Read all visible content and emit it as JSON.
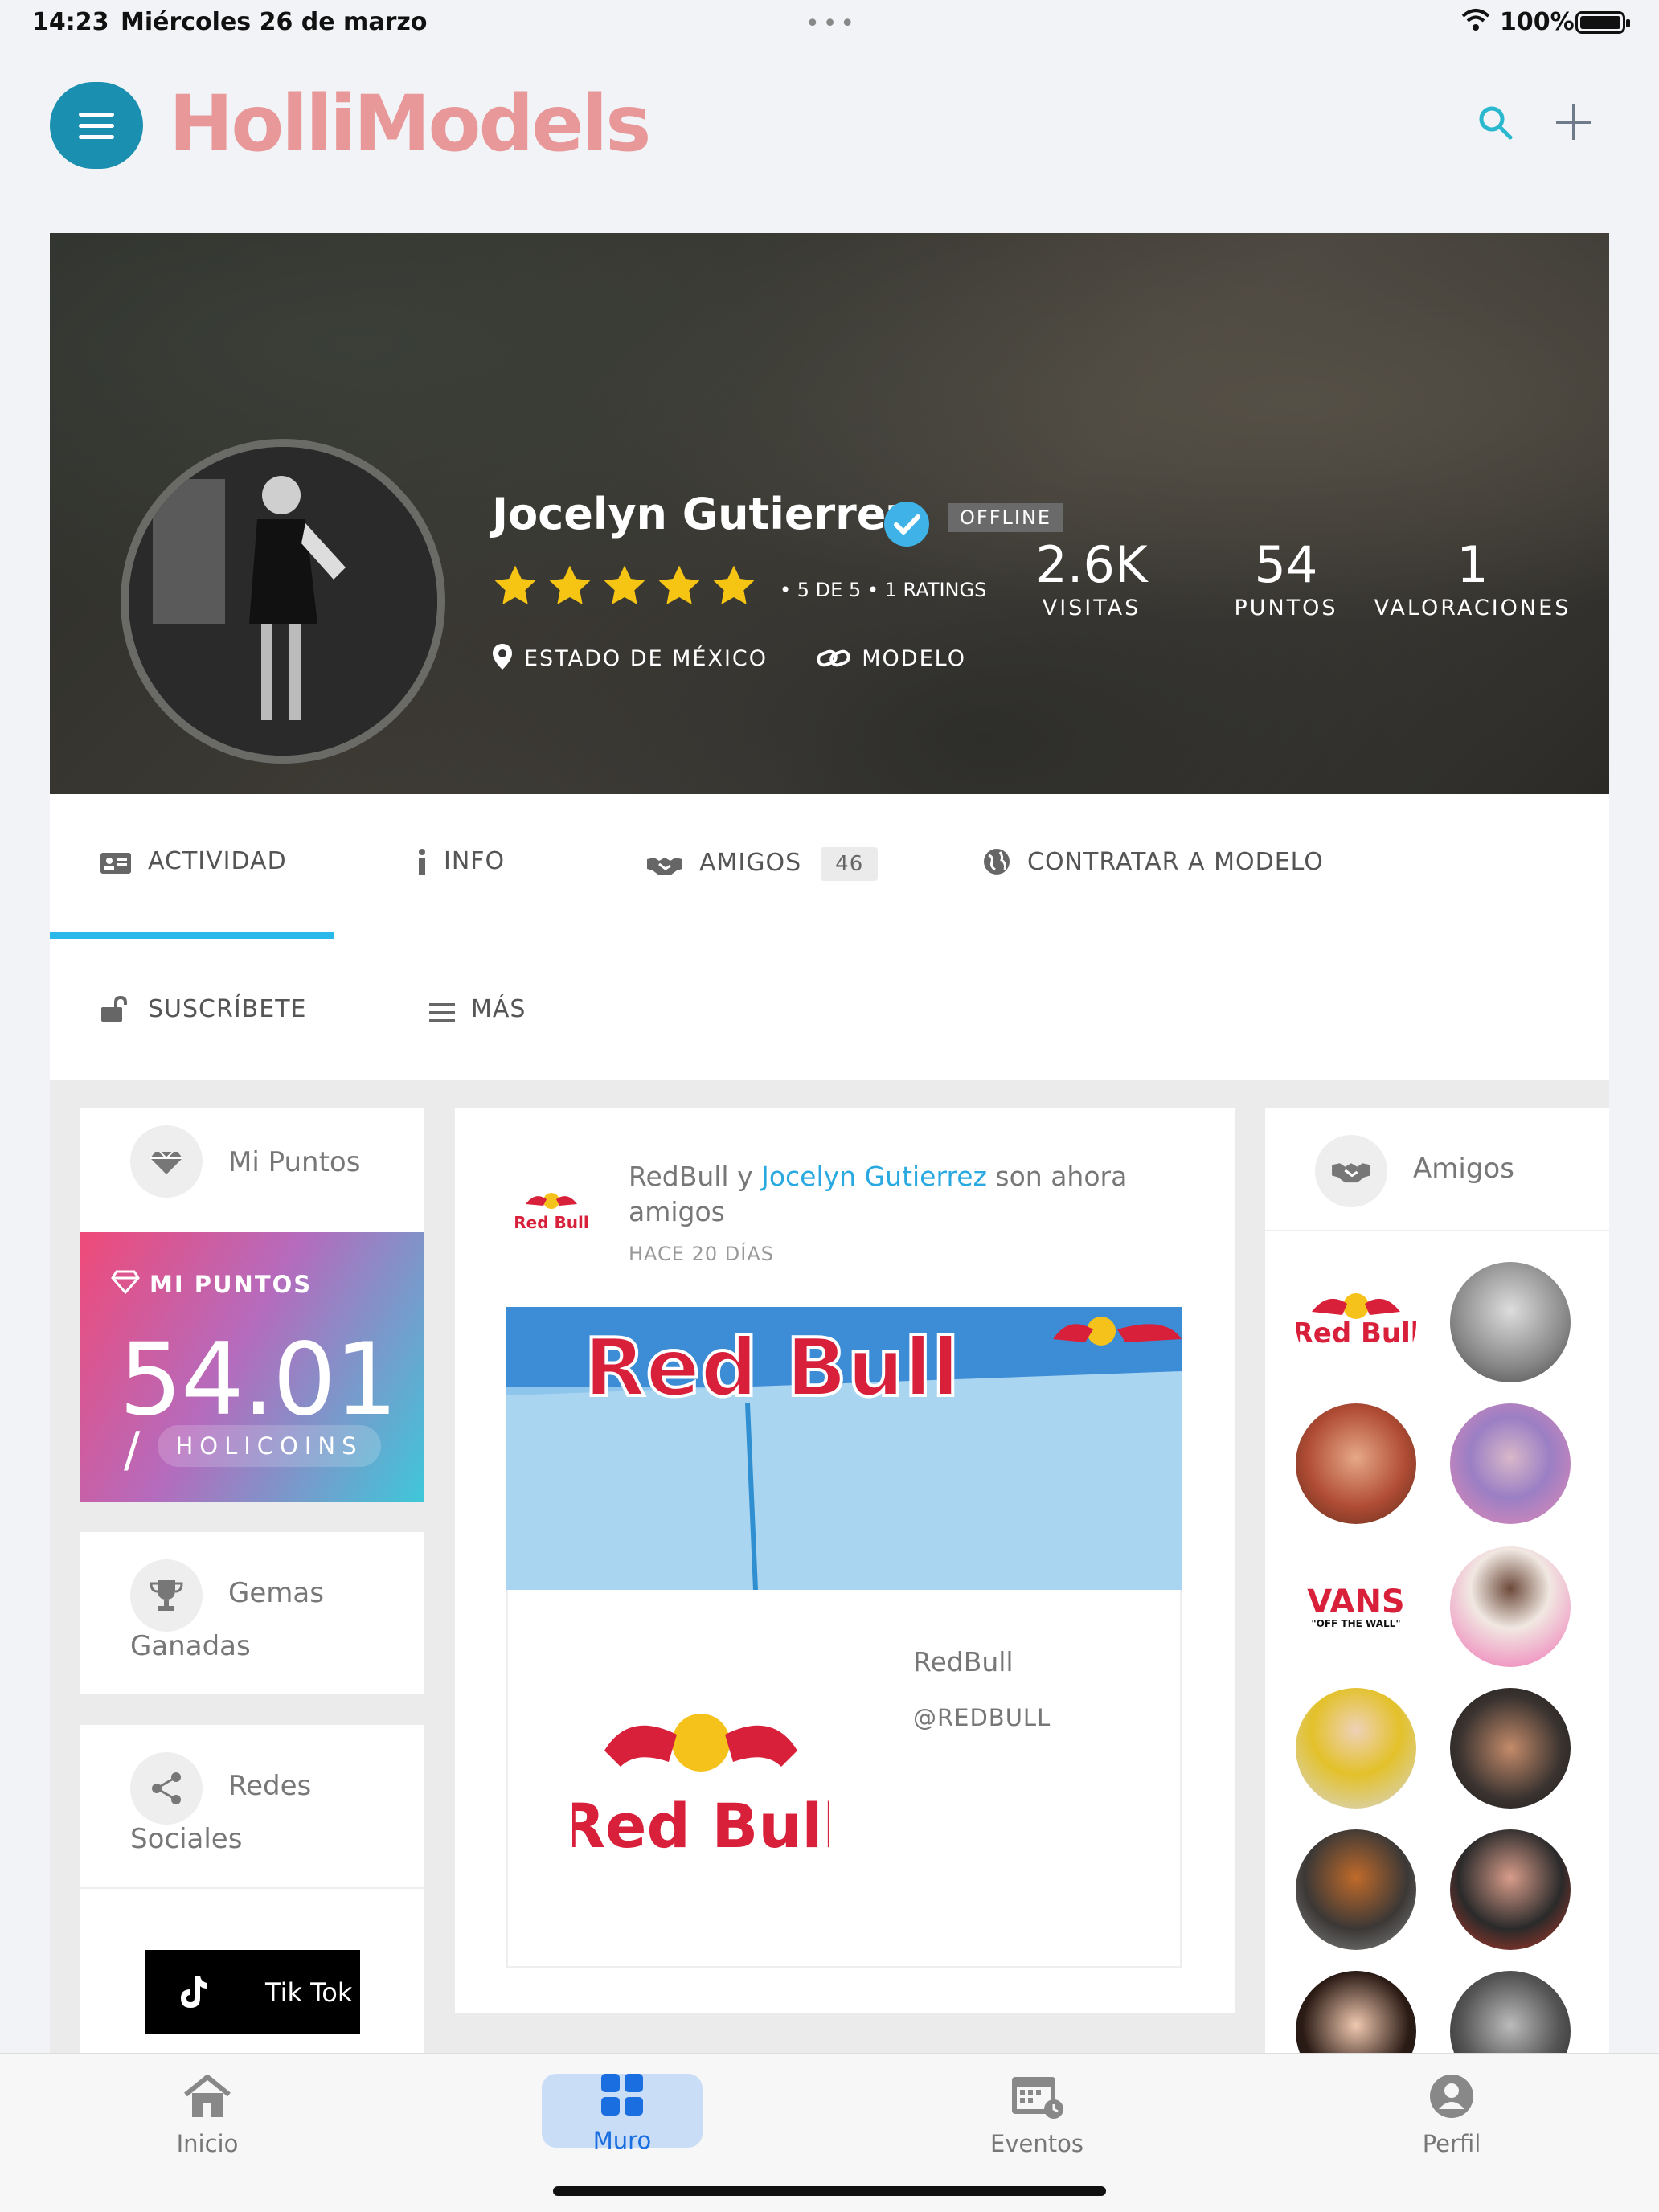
{
  "status_bar": {
    "time": "14:23",
    "date": "Miércoles 26 de marzo",
    "dots": "•••",
    "battery": "100%"
  },
  "header": {
    "logo": "HolliModels",
    "brand_color": "#e89898",
    "accent_color": "#1a8fb0"
  },
  "profile": {
    "name": "Jocelyn Gutierrez",
    "status_badge": "OFFLINE",
    "stars": 5,
    "rating_text": "•   5 DE 5   •   1 RATINGS",
    "location": "ESTADO DE MÉXICO",
    "role": "MODELO",
    "stats": [
      {
        "value": "2.6K",
        "label": "VISITAS"
      },
      {
        "value": "54",
        "label": "PUNTOS"
      },
      {
        "value": "1",
        "label": "VALORACIONES"
      }
    ]
  },
  "tabs": {
    "actividad": "ACTIVIDAD",
    "info": "INFO",
    "amigos": "AMIGOS",
    "amigos_count": "46",
    "contratar": "CONTRATAR A MODELO",
    "suscribete": "SUSCRÍBETE",
    "mas": "MÁS"
  },
  "left_sidebar": {
    "points_card_title": "Mi Puntos",
    "points_box_label": "MI PUNTOS",
    "points_value": "54.01",
    "points_slash": "/",
    "points_unit": "HOLICOINS",
    "gems_title_1": "Gemas",
    "gems_title_2": "Ganadas",
    "social_title_1": "Redes",
    "social_title_2": "Sociales",
    "tiktok_label": "Tik Tok"
  },
  "feed": {
    "actor": "RedBull",
    "connector": " y ",
    "friend_link": "Jocelyn Gutierrez",
    "action": " son ahora amigos",
    "time": "HACE 20 DÍAS",
    "banner_text": "Red Bull",
    "preview_name": "RedBull",
    "preview_handle": "@REDBULL",
    "logo_text": "Red Bull",
    "logo_small": "Red Bull"
  },
  "friends_card": {
    "title": "Amigos",
    "logo_redbull": "Red Bull",
    "logo_vans": "VANS",
    "logo_vans_sub": "\"OFF THE WALL\""
  },
  "bottom_nav": {
    "inicio": "Inicio",
    "muro": "Muro",
    "eventos": "Eventos",
    "perfil": "Perfil"
  }
}
